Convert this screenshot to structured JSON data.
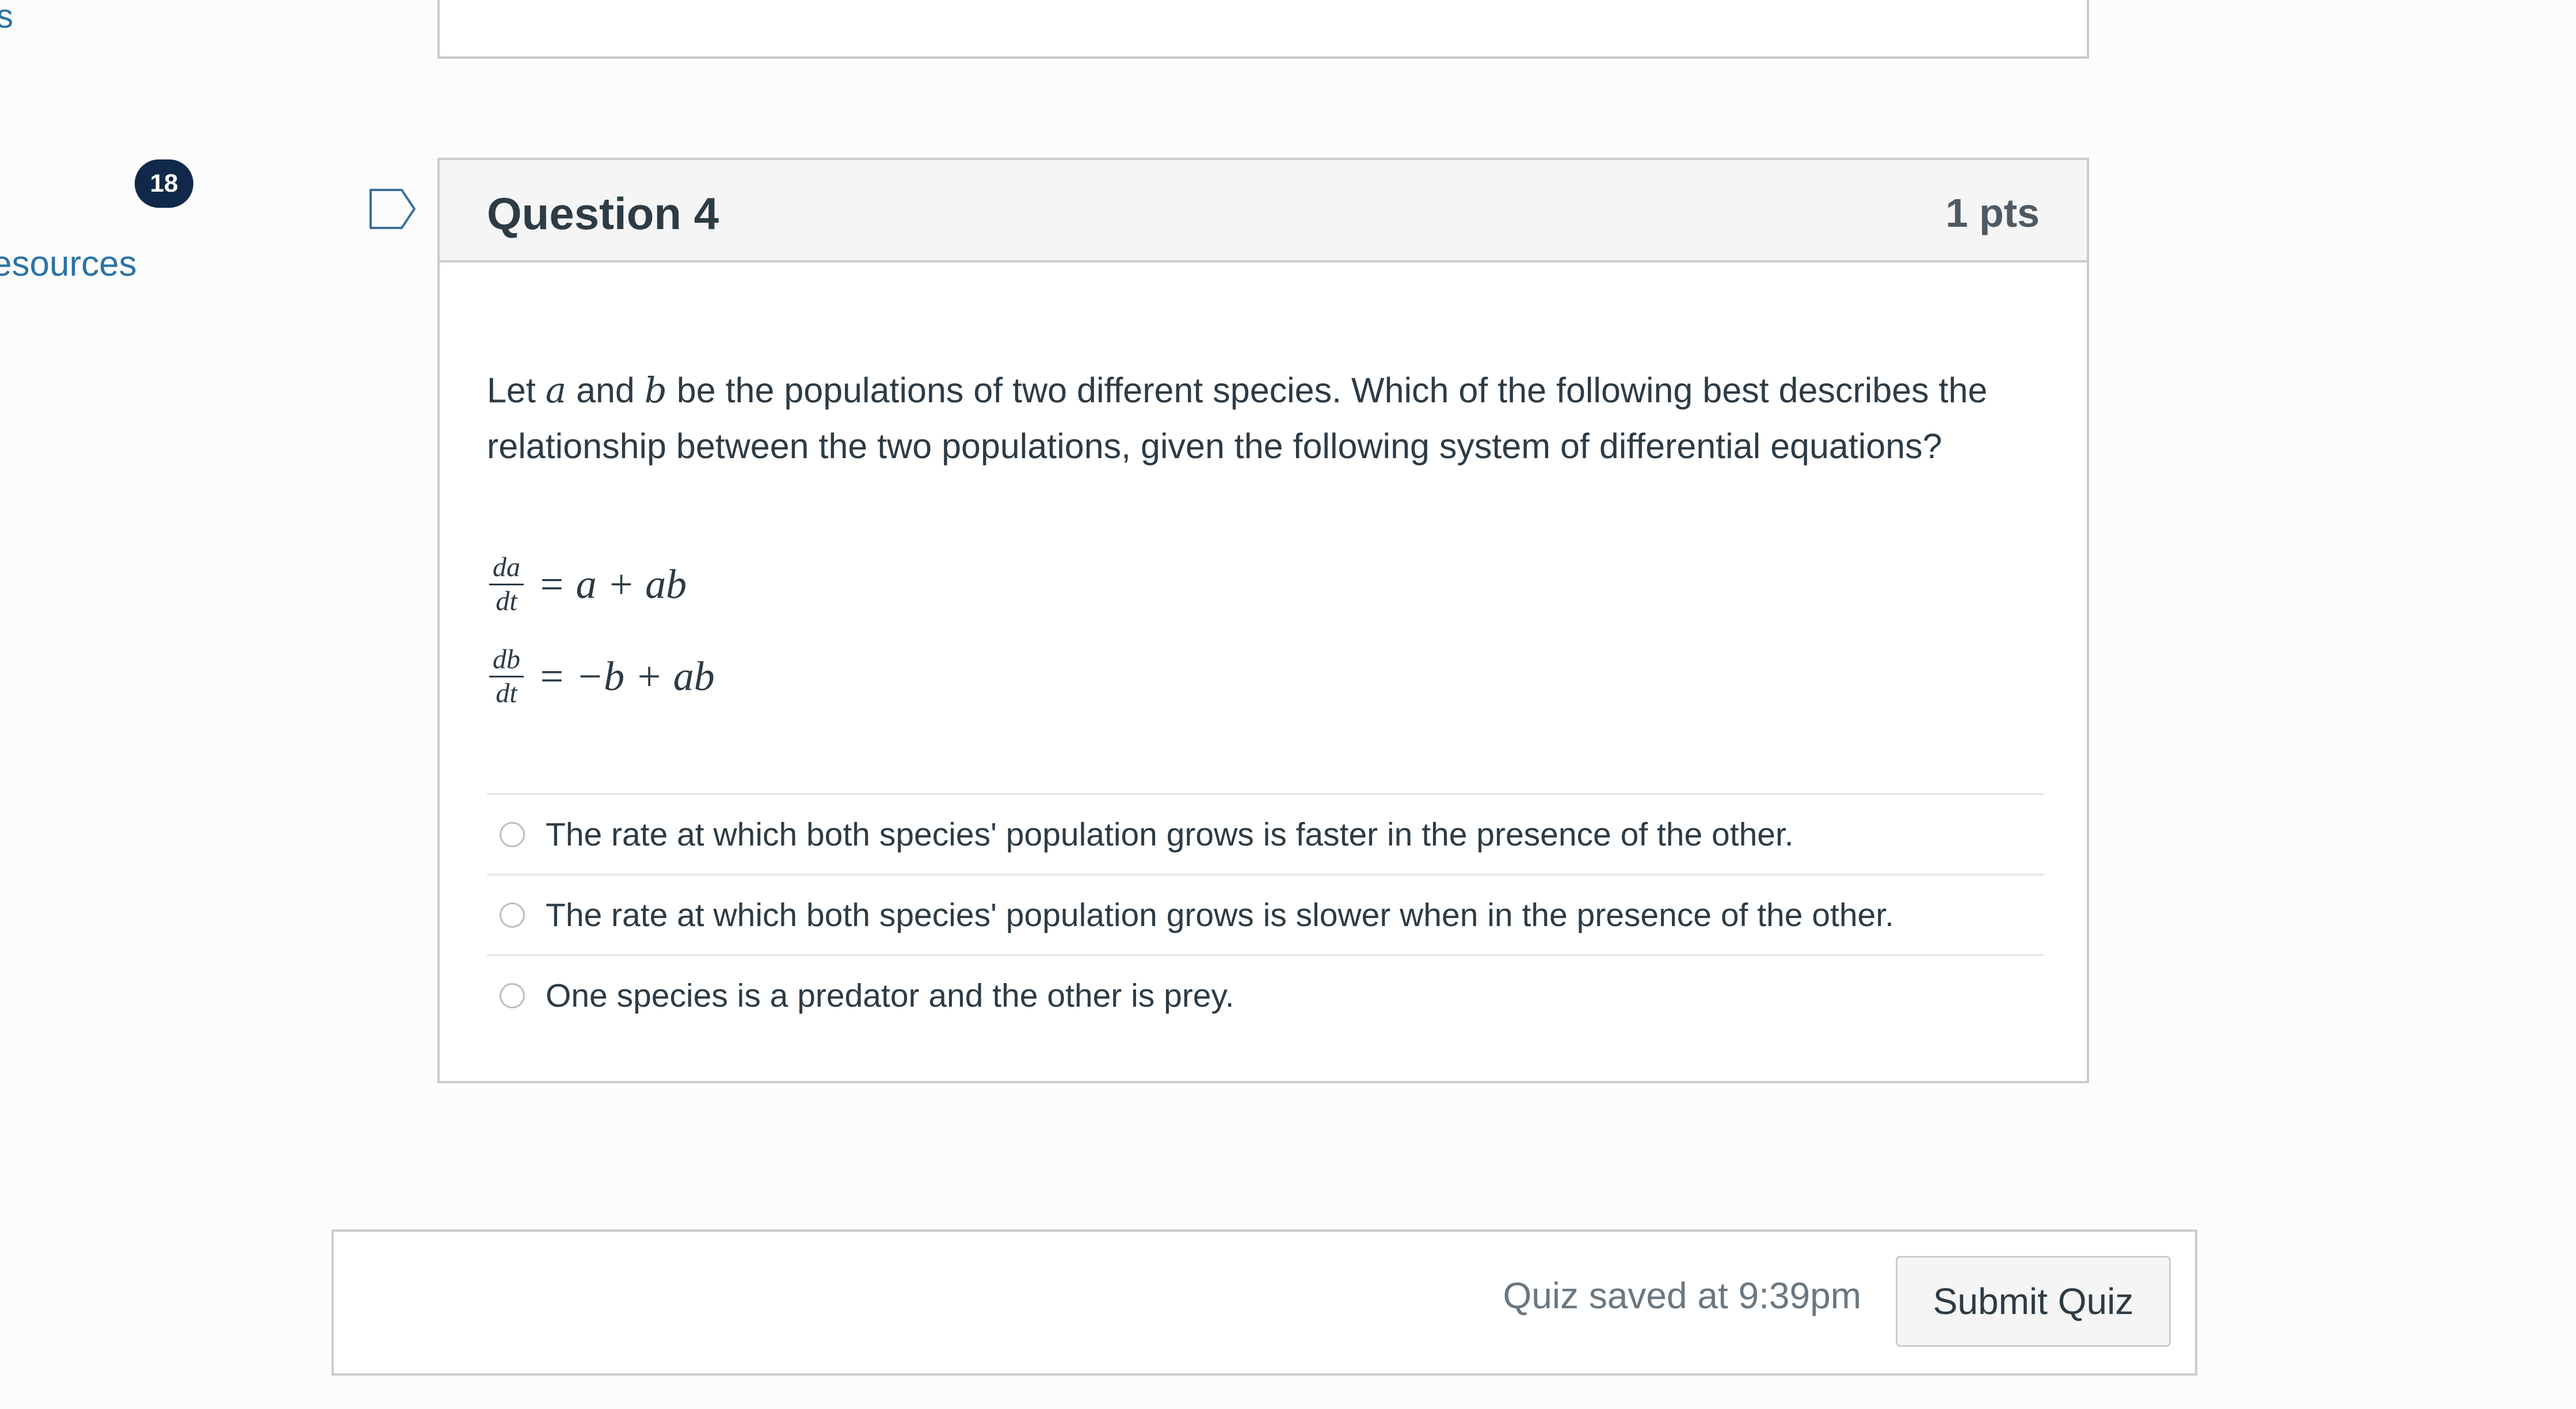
{
  "sidebar": {
    "partial_link": "s",
    "badge_count": "18",
    "resources_partial": "esources"
  },
  "question": {
    "title": "Question 4",
    "points": "1 pts",
    "text_parts": {
      "p1": "Let ",
      "var_a": "a",
      "p2": " and ",
      "var_b": "b",
      "p3": " be the populations of two different species. Which of the following best describes the relationship between the two populations, given the following system of differential equations?"
    },
    "equations": [
      {
        "num": "da",
        "den": "dt",
        "rhs": "= a + ab"
      },
      {
        "num": "db",
        "den": "dt",
        "rhs": "= −b + ab"
      }
    ],
    "answers": [
      "The rate at which both species' population grows is faster in the presence of the other.",
      "The rate at which both species' population grows is slower when in the presence of the other.",
      "One species is a predator and the other is prey."
    ]
  },
  "footer": {
    "saved_status": "Quiz saved at 9:39pm",
    "submit_label": "Submit Quiz"
  },
  "icons": {
    "flag": "bookmark-flag-icon"
  },
  "colors": {
    "link": "#2b73a5",
    "badge": "#10294a",
    "text": "#2d3b45"
  }
}
